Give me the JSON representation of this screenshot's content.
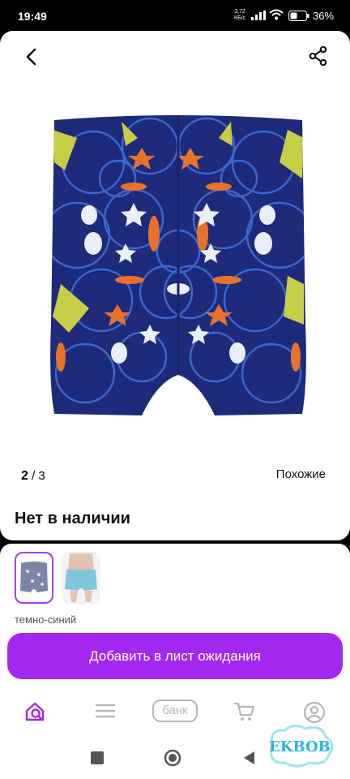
{
  "status_bar": {
    "time": "19:49",
    "net_speed": "3,72",
    "net_unit": "КБ/с",
    "battery": "36%"
  },
  "gallery": {
    "current": "2",
    "separator": "/",
    "total": "3",
    "similar_label": "Похожие"
  },
  "product": {
    "availability": "Нет в наличии",
    "color_name": "темно-синий"
  },
  "cta": {
    "label": "Добавить в лист ожидания"
  },
  "bottom_nav": {
    "bank_label": "банк"
  },
  "watermark": {
    "text": "EKBOB"
  },
  "colors": {
    "accent": "#a228f0",
    "shorts_base": "#1e2a7a"
  }
}
